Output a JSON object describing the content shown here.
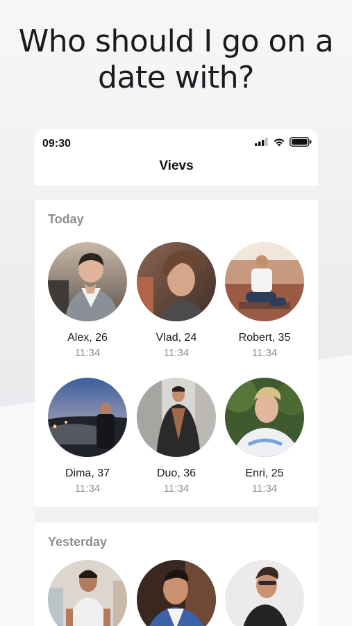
{
  "headline": "Who should I go on a date with?",
  "status": {
    "time": "09:30"
  },
  "nav": {
    "title": "Vievs"
  },
  "sections": [
    {
      "title": "Today",
      "people": [
        {
          "name": "Alex, 26",
          "time": "11:34"
        },
        {
          "name": "Vlad, 24",
          "time": "11:34"
        },
        {
          "name": "Robert, 35",
          "time": "11:34"
        },
        {
          "name": "Dima, 37",
          "time": "11:34"
        },
        {
          "name": "Duo, 36",
          "time": "11:34"
        },
        {
          "name": "Enri, 25",
          "time": "11:34"
        }
      ]
    },
    {
      "title": "Yesterday",
      "people": [
        {
          "name": "",
          "time": ""
        },
        {
          "name": "",
          "time": ""
        },
        {
          "name": "",
          "time": ""
        }
      ]
    }
  ]
}
